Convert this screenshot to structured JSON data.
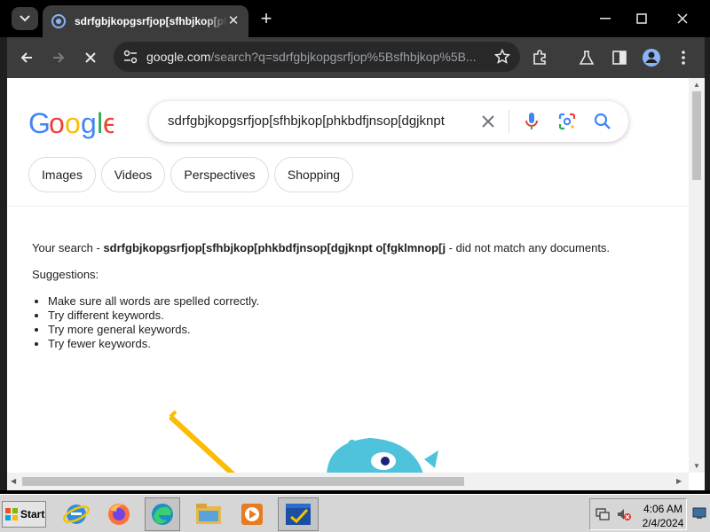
{
  "browser": {
    "tab_title": "sdrfgbjkopgsrfjop[sfhbjkop[phkbdfjnsop",
    "tab_close": "✕",
    "new_tab": "+",
    "url_host": "google.com",
    "url_rest": "/search?q=sdrfgbjkopgsrfjop%5Bsfhbjkop%5B..."
  },
  "search": {
    "logo": "Google",
    "query": "sdrfgbjkopgsrfjop[sfhbjkop[phkbdfjnsop[dgjknpt",
    "chips": [
      "Images",
      "Videos",
      "Perspectives",
      "Shopping"
    ]
  },
  "result": {
    "prefix": "Your search - ",
    "query_bold": "sdrfgbjkopgsrfjop[sfhbjkop[phkbdfjnsop[dgjknpt o[fgklmnop[j",
    "suffix": " - did not match any documents.",
    "suggestions_label": "Suggestions:",
    "suggestions": [
      "Make sure all words are spelled correctly.",
      "Try different keywords.",
      "Try more general keywords.",
      "Try fewer keywords."
    ]
  },
  "taskbar": {
    "start_label": "Start",
    "time": "4:06 AM",
    "date": "2/4/2024"
  },
  "colors": {
    "google_blue": "#4285f4",
    "google_red": "#ea4335",
    "google_yellow": "#fbbc05",
    "google_green": "#34a853"
  }
}
